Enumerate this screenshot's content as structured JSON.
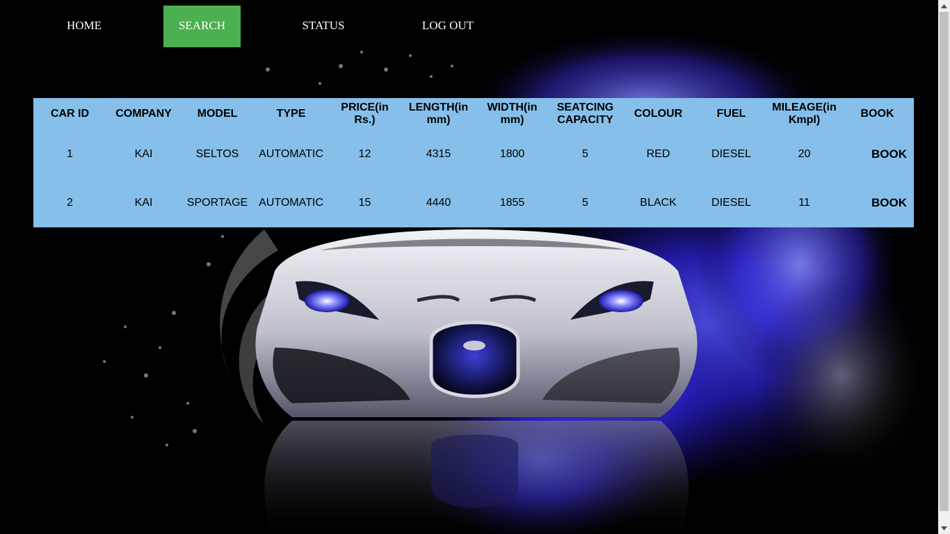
{
  "nav": {
    "items": [
      {
        "label": "HOME",
        "active": false
      },
      {
        "label": "SEARCH",
        "active": true
      },
      {
        "label": "STATUS",
        "active": false
      },
      {
        "label": "LOG OUT",
        "active": false
      }
    ],
    "active_color": "#4CAF50"
  },
  "table": {
    "background_color": "#86bfe9",
    "headers": [
      "CAR ID",
      "COMPANY",
      "MODEL",
      "TYPE",
      "PRICE(in Rs.)",
      "LENGTH(in mm)",
      "WIDTH(in mm)",
      "SEATCING CAPACITY",
      "COLOUR",
      "FUEL",
      "MILEAGE(in Kmpl)",
      "BOOK"
    ],
    "rows": [
      {
        "cells": [
          "1",
          "KAI",
          "SELTOS",
          "AUTOMATIC",
          "12",
          "4315",
          "1800",
          "5",
          "RED",
          "DIESEL",
          "20"
        ],
        "book_label": "BOOK"
      },
      {
        "cells": [
          "2",
          "KAI",
          "SPORTAGE",
          "AUTOMATIC",
          "15",
          "4440",
          "1855",
          "5",
          "BLACK",
          "DIESEL",
          "11"
        ],
        "book_label": "BOOK"
      }
    ]
  },
  "background": {
    "icon": "sports-car-blue-smoke-image",
    "accent_color": "#3a36ff"
  },
  "scrollbar": {
    "up_icon": "scroll-up-arrow-icon",
    "down_icon": "scroll-down-arrow-icon"
  }
}
